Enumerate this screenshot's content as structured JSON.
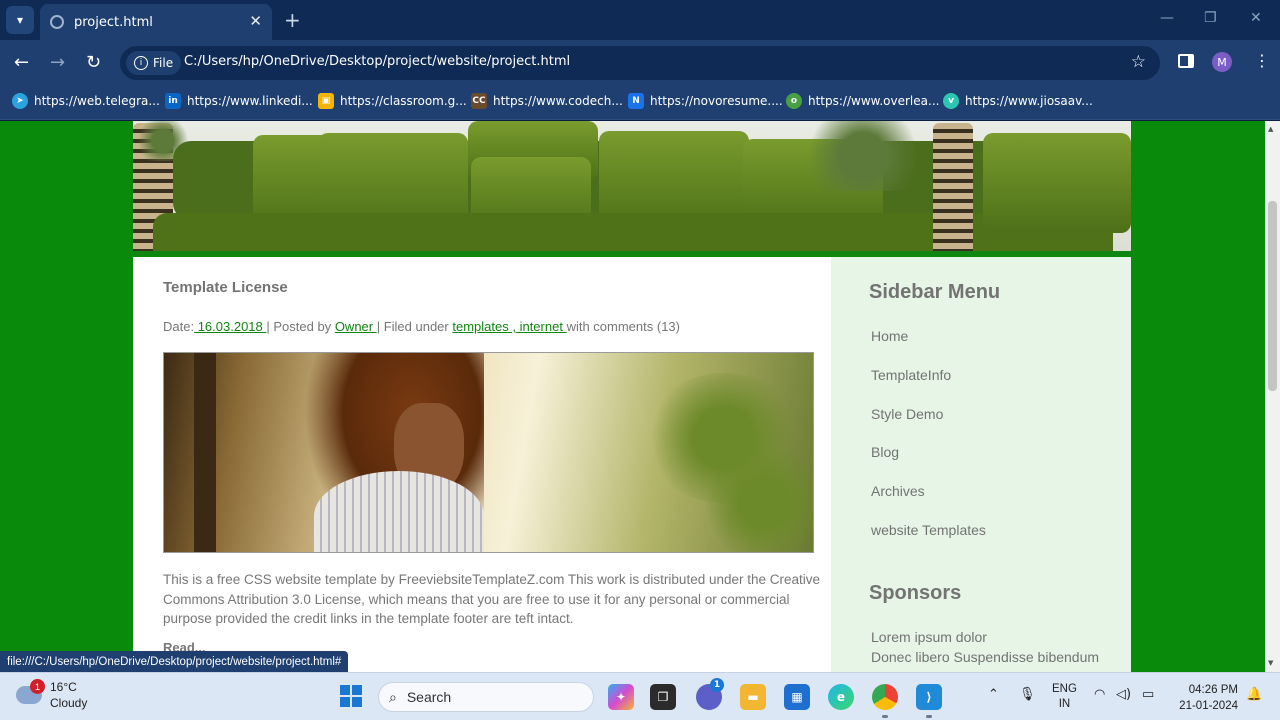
{
  "browser": {
    "tab_title": "project.html",
    "file_chip": "File",
    "url": "C:/Users/hp/OneDrive/Desktop/project/website/project.html",
    "profile_initial": "M",
    "status_url": "file:///C:/Users/hp/OneDrive/Desktop/project/website/project.html#"
  },
  "bookmarks": [
    {
      "label": "https://web.telegra...",
      "icon": "telegram-icon",
      "color": "#2aa3e0"
    },
    {
      "label": "https://www.linkedi...",
      "icon": "linkedin-icon",
      "color": "#0a66c2"
    },
    {
      "label": "https://classroom.g...",
      "icon": "classroom-icon",
      "color": "#f5b400"
    },
    {
      "label": "https://www.codech...",
      "icon": "codechef-icon",
      "color": "#6b4a2e"
    },
    {
      "label": "https://novoresume....",
      "icon": "novoresume-icon",
      "color": "#1a73e8"
    },
    {
      "label": "https://www.overlea...",
      "icon": "overleaf-icon",
      "color": "#47a141"
    },
    {
      "label": "https://www.jiosaav...",
      "icon": "jiosaavn-icon",
      "color": "#2bc5b4"
    }
  ],
  "post": {
    "title": "Template License",
    "date_label": "Date:",
    "date": " 16.03.2018 ",
    "posted_by": "| Posted by",
    "author": "Owner ",
    "filed_under": "| Filed under",
    "tag1": "templates ,",
    "tag2": " internet ",
    "comments": "with comments (13)",
    "body": "This is a free CSS website template by FreeviebsiteTemplateZ.com This work is distributed under the Creative Commons Attribution 3.0 License, which means that you are free to use it for any personal or commercial purpose provided the credit links in the template footer are teft intact.",
    "read_more": "Read..."
  },
  "sidebar": {
    "menu_title": "Sidebar Menu",
    "menu_items": [
      "Home",
      "TemplateInfo",
      "Style Demo",
      "Blog",
      "Archives",
      "website Templates"
    ],
    "sponsors_title": "Sponsors",
    "sponsor_lines": [
      "Lorem ipsum dolor",
      "Donec libero Suspendisse bibendum"
    ]
  },
  "taskbar": {
    "weather_badge": "1",
    "temperature": "16°C",
    "condition": "Cloudy",
    "search_label": "Search",
    "chat_badge": "1",
    "lang_line1": "ENG",
    "lang_line2": "IN",
    "time": "04:26 PM",
    "date": "21-01-2024"
  }
}
